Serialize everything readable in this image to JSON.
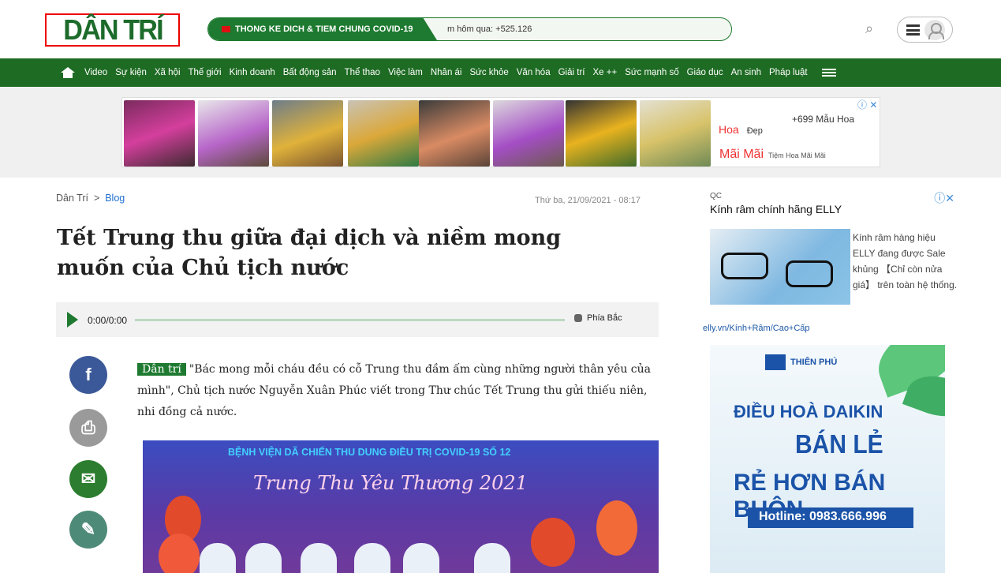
{
  "header": {
    "logo_text": "DÂN TRÍ",
    "covid": {
      "label": "THONG KE DICH & TIEM CHUNG COVID-19",
      "stat": "m hôm qua: +525.126"
    }
  },
  "nav": {
    "items": [
      "Video",
      "Sự kiện",
      "Xã hội",
      "Thế giới",
      "Kinh doanh",
      "Bất động sản",
      "Thể thao",
      "Việc làm",
      "Nhân ái",
      "Sức khỏe",
      "Văn hóa",
      "Giải trí",
      "Xe ++",
      "Sức mạnh số",
      "Giáo dục",
      "An sinh",
      "Pháp luật"
    ]
  },
  "top_ad": {
    "line1": "+699 Mẫu Hoa",
    "line2": "Hoa",
    "line2b": "Đẹp",
    "line3": "Mãi Mãi",
    "line3b": "Tiệm Hoa Mãi Mãi"
  },
  "breadcrumb": {
    "home": "Dân Trí",
    "section": "Blog"
  },
  "date": "Thứ ba, 21/09/2021 - 08:17",
  "title_lines": [
    "Tết Trung thu giữa đại dịch và niềm mong",
    "muốn của Chủ tịch nước"
  ],
  "audio": {
    "time": "0:00/0:00",
    "voice": "Phía Bắc"
  },
  "article": {
    "tag": "Dân trí",
    "text": "\"Bác mong mỗi cháu đều có cỗ Trung thu đầm ấm cùng những người thân yêu của mình\", Chủ tịch nước Nguyễn Xuân Phúc viết trong Thư chúc Tết Trung thu gửi thiếu niên, nhi đồng cả nước."
  },
  "photo": {
    "caption": "BỆNH VIỆN DÃ CHIẾN THU DUNG ĐIỀU TRỊ COVID-19 SỐ 12",
    "title": "Trung Thu Yêu Thương 2021"
  },
  "side_ad": {
    "qc": "QC",
    "headline": "Kính râm chính hãng ELLY",
    "desc": "Kính râm hàng hiệu ELLY đang được Sale khủng 【Chỉ còn nửa giá】 trên toàn hệ thống.",
    "url": "elly.vn/Kính+Râm/Cao+Cấp"
  },
  "side_banner": {
    "brand": "THIÊN PHÚ",
    "line1": "ĐIỀU HOÀ DAIKIN",
    "line2": "BÁN LẺ",
    "line3": "RẺ HƠN BÁN BUÔN",
    "hotline": "Hotline: 0983.666.996"
  },
  "colors": {
    "brand_green": "#1e6b23",
    "link_blue": "#1f6fcf",
    "ad_red": "#e33"
  },
  "icons": [
    "home-icon",
    "search-icon",
    "menu-icon",
    "user-icon",
    "play-icon",
    "facebook-icon",
    "print-icon",
    "comment-icon",
    "edit-icon",
    "close-icon"
  ]
}
